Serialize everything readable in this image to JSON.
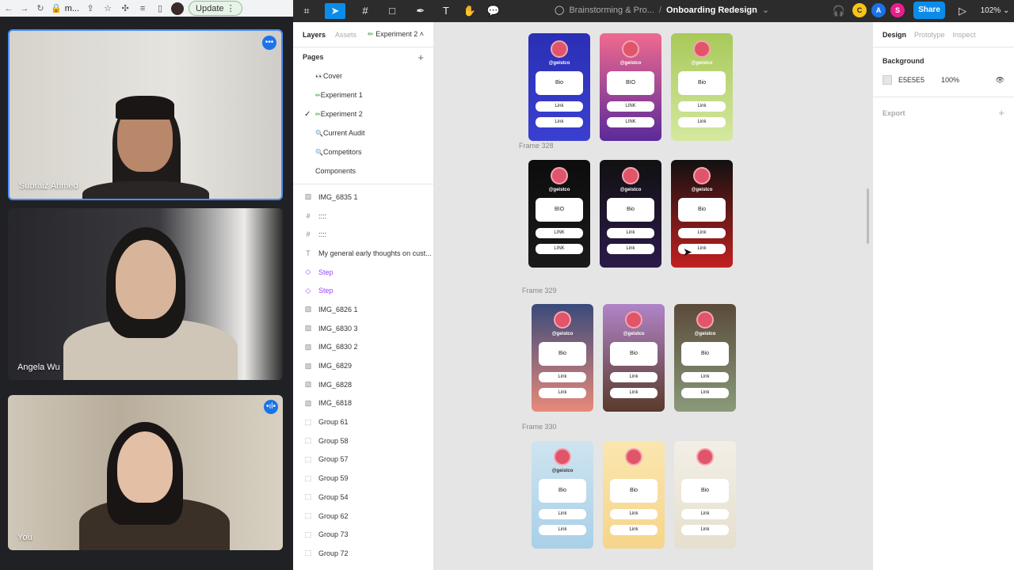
{
  "browser": {
    "url_short": "m...",
    "update_label": "Update"
  },
  "participants": [
    {
      "name": "Subraiz Ahmed",
      "badge": "•••"
    },
    {
      "name": "Angela Wu",
      "badge": ""
    },
    {
      "name": "You",
      "badge": "•ıl•"
    }
  ],
  "topbar": {
    "project": "Brainstorming & Pro...",
    "separator": "/",
    "file": "Onboarding Redesign",
    "avatars": [
      {
        "letter": "C",
        "color": "#f5c518"
      },
      {
        "letter": "A",
        "color": "#1a73e8"
      },
      {
        "letter": "S",
        "color": "#e91e8c"
      }
    ],
    "share_label": "Share",
    "zoom": "102%"
  },
  "layers_panel": {
    "tab_layers": "Layers",
    "tab_assets": "Assets",
    "current_page": "Experiment 2",
    "pages_heading": "Pages",
    "pages": [
      {
        "label": "Cover",
        "icon": "👀",
        "active": false
      },
      {
        "label": "Experiment 1",
        "icon": "✏",
        "active": false
      },
      {
        "label": "Experiment 2",
        "icon": "✏",
        "active": true
      },
      {
        "label": "Current Audit",
        "icon": "🔍",
        "active": false
      },
      {
        "label": "Competitors",
        "icon": "🔍",
        "active": false
      },
      {
        "label": "Components",
        "icon": "",
        "active": false
      }
    ],
    "layers": [
      {
        "label": "IMG_6835 1",
        "icon": "image-icon"
      },
      {
        "label": "::::",
        "icon": "frame-icon"
      },
      {
        "label": "::::",
        "icon": "frame-icon"
      },
      {
        "label": "My general early thoughts on cust...",
        "icon": "text-icon"
      },
      {
        "label": "Step",
        "icon": "component-icon"
      },
      {
        "label": "Step",
        "icon": "component-icon"
      },
      {
        "label": "IMG_6826 1",
        "icon": "image-icon"
      },
      {
        "label": "IMG_6830 3",
        "icon": "image-icon"
      },
      {
        "label": "IMG_6830 2",
        "icon": "image-icon"
      },
      {
        "label": "IMG_6829",
        "icon": "image-icon"
      },
      {
        "label": "IMG_6828",
        "icon": "image-icon"
      },
      {
        "label": "IMG_6818",
        "icon": "image-icon"
      },
      {
        "label": "Group 61",
        "icon": "group-icon"
      },
      {
        "label": "Group 58",
        "icon": "group-icon"
      },
      {
        "label": "Group 57",
        "icon": "group-icon"
      },
      {
        "label": "Group 59",
        "icon": "group-icon"
      },
      {
        "label": "Group 54",
        "icon": "group-icon"
      },
      {
        "label": "Group 62",
        "icon": "group-icon"
      },
      {
        "label": "Group 73",
        "icon": "group-icon"
      },
      {
        "label": "Group 72",
        "icon": "group-icon"
      }
    ]
  },
  "canvas": {
    "frame_labels": [
      "Frame 328",
      "Frame 329",
      "Frame 330"
    ],
    "rows": [
      [
        {
          "handle": "@geistco",
          "bio": "Bio",
          "link": "Link",
          "bg": "#2a2fb5",
          "bg2": "#3b3fd0"
        },
        {
          "handle": "@geistco",
          "bio": "BIO",
          "link": "LINK",
          "bg": "#f06a8f",
          "bg2": "#5a2a9a"
        },
        {
          "handle": "@geistco",
          "bio": "Bio",
          "link": "Link",
          "bg": "#a8c95a",
          "bg2": "#d5e8a0"
        }
      ],
      [
        {
          "handle": "@geistco",
          "bio": "BIO",
          "link": "LINK",
          "bg": "#0d0d0d",
          "bg2": "#1a1a1a"
        },
        {
          "handle": "@geistco",
          "bio": "Bio",
          "link": "Link",
          "bg": "#111111",
          "bg2": "#2b1a4a"
        },
        {
          "handle": "@geistco",
          "bio": "Bio",
          "link": "Link",
          "bg": "#111111",
          "bg2": "#c22020"
        }
      ],
      [
        {
          "handle": "@geistco",
          "bio": "Bio",
          "link": "Link",
          "bg": "#3a4a7a",
          "bg2": "#e88a7a"
        },
        {
          "handle": "@geistco",
          "bio": "Bio",
          "link": "Link",
          "bg": "#b084c8",
          "bg2": "#5a3a2a"
        },
        {
          "handle": "@geistco",
          "bio": "Bio",
          "link": "Link",
          "bg": "#5a4a3a",
          "bg2": "#8a9a7a"
        }
      ],
      [
        {
          "handle": "@geistco",
          "bio": "Bio",
          "link": "Link",
          "bg": "#cfe4f0",
          "bg2": "#a8d0e8"
        },
        {
          "handle": "",
          "bio": "Bio",
          "link": "Link",
          "bg": "#fbe6b0",
          "bg2": "#f5d58a"
        },
        {
          "handle": "",
          "bio": "Bio",
          "link": "Link",
          "bg": "#f3efe6",
          "bg2": "#e6dfcf"
        }
      ]
    ]
  },
  "design_panel": {
    "tabs": [
      "Design",
      "Prototype",
      "Inspect"
    ],
    "background_heading": "Background",
    "bg_hex": "E5E5E5",
    "bg_opacity": "100%",
    "export_heading": "Export"
  }
}
